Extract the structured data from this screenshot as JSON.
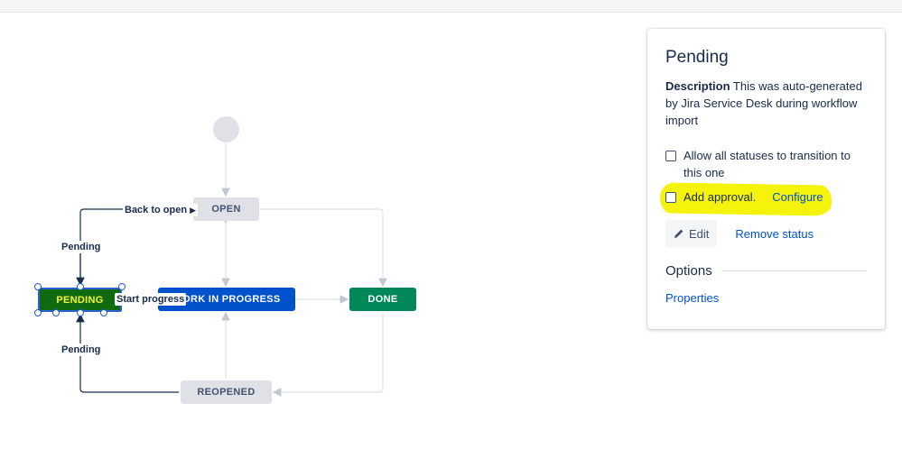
{
  "diagram": {
    "statuses": {
      "open": "OPEN",
      "work_in_progress": "WORK IN PROGRESS",
      "done": "DONE",
      "reopened": "REOPENED",
      "pending": "PENDING"
    },
    "transitions": {
      "back_to_open": "Back to open",
      "pending_top": "Pending",
      "pending_bottom": "Pending",
      "start_progress": "Start progress"
    },
    "colors": {
      "open": "#dfe1e6",
      "work_in_progress": "#0052cc",
      "done": "#00875a",
      "pending_selected": "#0f6a10",
      "highlight": "#f5f20c"
    }
  },
  "panel": {
    "title": "Pending",
    "description_label": "Description",
    "description_text": "This was auto-generated by Jira Service Desk during workflow import",
    "allow_all_label": "Allow all statuses to transition to this one",
    "add_approval_label": "Add approval.",
    "configure_label": "Configure",
    "edit_label": "Edit",
    "remove_status_label": "Remove status",
    "options_heading": "Options",
    "properties_label": "Properties"
  }
}
